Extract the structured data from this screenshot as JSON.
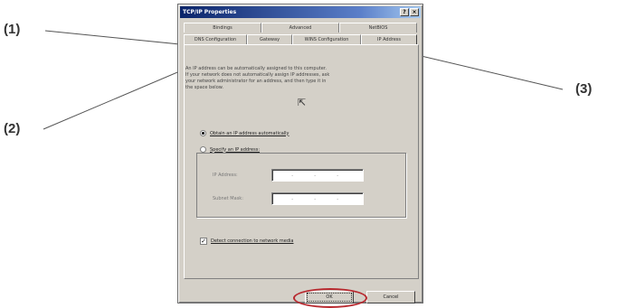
{
  "callouts": {
    "c1": "(1)",
    "c2": "(2)",
    "c3": "(3)"
  },
  "dialog": {
    "title": "TCP/IP Properties",
    "title_buttons": {
      "help": "?",
      "close": "×"
    },
    "tabs_row1": [
      "Bindings",
      "Advanced",
      "NetBIOS"
    ],
    "tabs_row2": [
      "DNS Configuration",
      "Gateway",
      "WINS Configuration",
      "IP Address"
    ],
    "active_tab": "IP Address",
    "description_lines": [
      "An IP address can be automatically assigned to this computer.",
      "If your network does not automatically assign IP addresses, ask",
      "your network administrator for an address, and then type it in",
      "the space below."
    ],
    "radio_auto": "Obtain an IP address automatically",
    "radio_specify": "Specify an IP address:",
    "ip_label": "IP Address:",
    "subnet_label": "Subnet Mask:",
    "ip_separator": ".",
    "checkbox_mark": "✓",
    "checkbox_label": "Detect connection to network media",
    "ok_label": "OK",
    "cancel_label": "Cancel"
  },
  "colors": {
    "highlight": "#b8292f",
    "titlebar": "#0a246a"
  },
  "icons": {
    "cursor": "mouse-cursor-icon"
  }
}
